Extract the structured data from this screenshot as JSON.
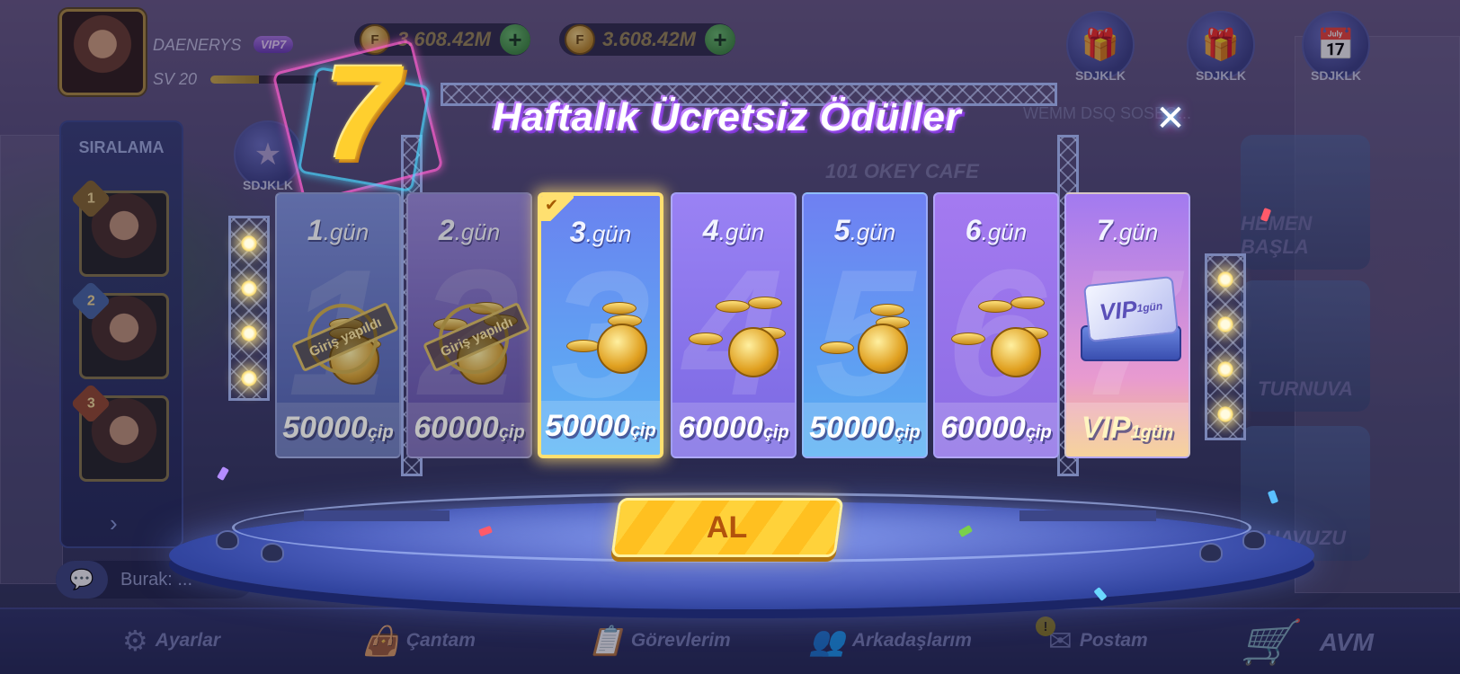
{
  "player": {
    "name": "DAENERYS",
    "vip": "VIP7",
    "level": "SV 20",
    "level_progress": 0.45
  },
  "currencies": [
    {
      "icon": "F",
      "value": "3.608.42M"
    },
    {
      "icon": "F",
      "value": "3.608.42M"
    }
  ],
  "top_icons": [
    {
      "label": "SDJKLK",
      "icon": "gift-icon"
    },
    {
      "label": "SDJKLK",
      "icon": "gift-icon"
    },
    {
      "label": "SDJKLK",
      "icon": "calendar-check-icon"
    }
  ],
  "left_icon": {
    "label": "SDJKLK"
  },
  "ranking": {
    "title": "SIRALAMA",
    "ranks": [
      "1",
      "2",
      "3"
    ]
  },
  "chat": {
    "text": "Burak: ..."
  },
  "background_texts": {
    "marquee": "WEMM DSQ   SOSEQ...",
    "cafe": "101 OKEY CAFE",
    "card1": "HEMEN BAŞLA",
    "card2": "TURNUVA",
    "card3": "HAVUZU"
  },
  "modal": {
    "title_number": "7",
    "title": "Haftalık Ücretsiz Ödüller",
    "close_symbol": "✕",
    "claim_button": "AL",
    "stamp_text": "Giriş yapıldı",
    "days": [
      {
        "num": "1",
        "suffix": ".gün",
        "amount": "50000",
        "unit": "çip",
        "status": "claimed"
      },
      {
        "num": "2",
        "suffix": ".gün",
        "amount": "60000",
        "unit": "çip",
        "status": "claimed"
      },
      {
        "num": "3",
        "suffix": ".gün",
        "amount": "50000",
        "unit": "çip",
        "status": "current"
      },
      {
        "num": "4",
        "suffix": ".gün",
        "amount": "60000",
        "unit": "çip",
        "status": "locked"
      },
      {
        "num": "5",
        "suffix": ".gün",
        "amount": "50000",
        "unit": "çip",
        "status": "locked"
      },
      {
        "num": "6",
        "suffix": ".gün",
        "amount": "60000",
        "unit": "çip",
        "status": "locked"
      },
      {
        "num": "7",
        "suffix": ".gün",
        "amount": "VIP",
        "unit": "1gün",
        "status": "locked",
        "ticket": "VIP",
        "ticket_sub": "1gün"
      }
    ]
  },
  "bottom_nav": [
    {
      "label": "Ayarlar",
      "icon": "gear-icon"
    },
    {
      "label": "Çantam",
      "icon": "bag-icon"
    },
    {
      "label": "Görevlerim",
      "icon": "clipboard-icon"
    },
    {
      "label": "Arkadaşlarım",
      "icon": "friends-icon"
    },
    {
      "label": "Postam",
      "icon": "mail-icon",
      "badge": "!"
    },
    {
      "label": "AVM",
      "icon": "cart-icon"
    }
  ],
  "colors": {
    "day_cards": [
      "#5f7fe0",
      "#7a6fd6",
      "#5aa8f0",
      "#8a72e6",
      "#5a9ef0",
      "#9a70e0",
      "#d88ad8"
    ],
    "accent_gold": "#ffd23a",
    "title_glow": "#b06cff"
  }
}
